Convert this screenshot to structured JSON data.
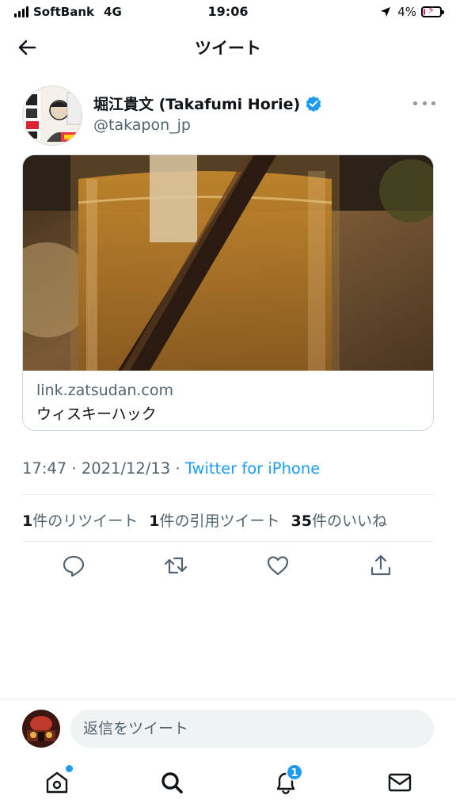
{
  "status_bar": {
    "carrier": "SoftBank",
    "network": "4G",
    "time": "19:06",
    "battery": "4%",
    "battery_level": 0.04
  },
  "header": {
    "title": "ツイート",
    "back_icon": "arrow-left-icon"
  },
  "tweet": {
    "author_name": "堀江貴文 (Takafumi Horie)",
    "author_handle": "@takapon_jp",
    "verified": true,
    "card": {
      "domain": "link.zatsudan.com",
      "title": "ウィスキーハック"
    },
    "time": "17:47",
    "date": "2021/12/13",
    "separator": "·",
    "source": "Twitter for iPhone",
    "stats": {
      "retweets_count": "1",
      "retweets_label": "件のリツイート",
      "quotes_count": "1",
      "quotes_label": "件の引用ツイート",
      "likes_count": "35",
      "likes_label": "件のいいね"
    }
  },
  "actions": [
    "reply-icon",
    "retweet-icon",
    "like-icon",
    "share-icon"
  ],
  "reply": {
    "placeholder": "返信をツイート"
  },
  "tabbar": {
    "notifications_badge": "1",
    "items": [
      "home-icon",
      "search-icon",
      "notifications-icon",
      "messages-icon"
    ]
  },
  "colors": {
    "accent": "#1d9bf0",
    "text": "#0f1419",
    "secondary": "#536471",
    "battery_low": "#e0245e"
  }
}
